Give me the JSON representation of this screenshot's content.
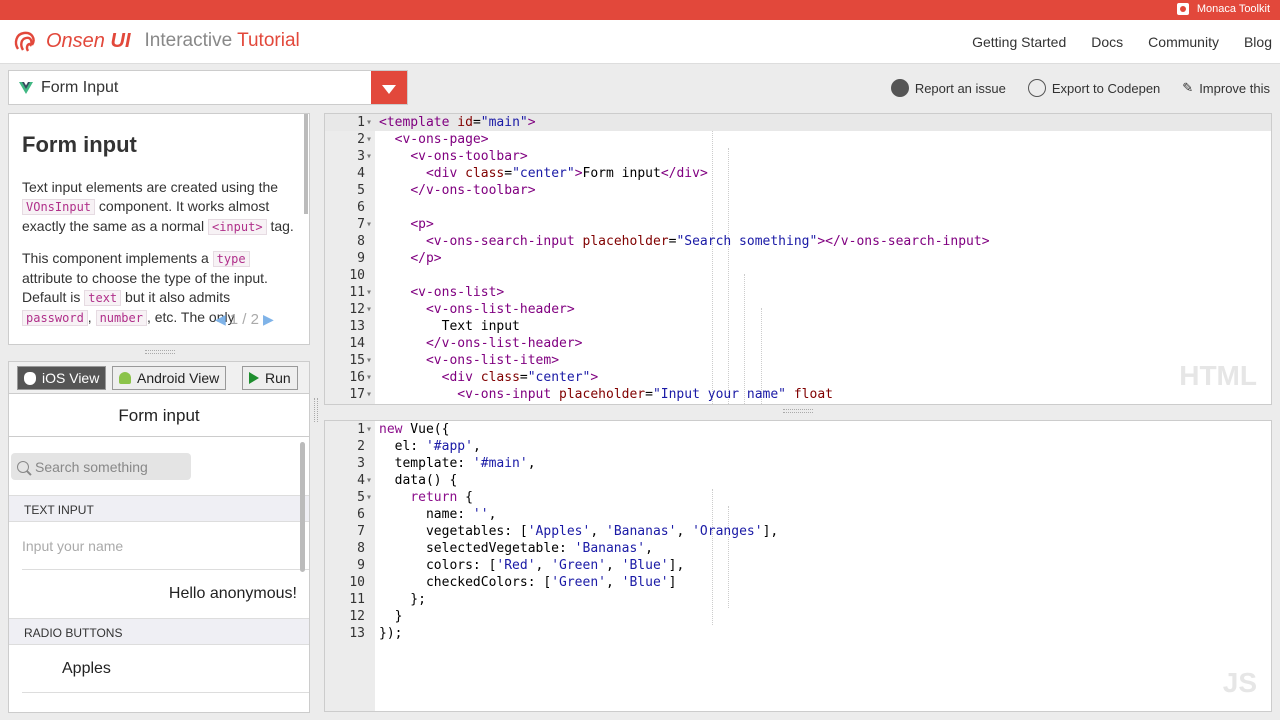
{
  "topbar": {
    "brand": "Monaca Toolkit",
    "bg": "#e2483b"
  },
  "header": {
    "logo_word1": "Onsen",
    "logo_word2": "UI",
    "subtitle1": "Interactive",
    "subtitle2": "Tutorial",
    "nav": [
      "Getting Started",
      "Docs",
      "Community",
      "Blog"
    ]
  },
  "selector": {
    "value": "Form Input"
  },
  "actions": {
    "report": "Report an issue",
    "export": "Export to Codepen",
    "improve": "Improve this"
  },
  "doc": {
    "title": "Form input",
    "p1_a": "Text input elements are created using the ",
    "p1_code1": "VOnsInput",
    "p1_b": " component. It works almost exactly the same as a normal ",
    "p1_code2": "<input>",
    "p1_c": " tag.",
    "p2_a": "This component implements a ",
    "p2_code1": "type",
    "p2_b": " attribute to choose the type of the input. Default is ",
    "p2_code2": "text",
    "p2_c": " but it also admits ",
    "p2_code3": "password",
    "p2_d": ", ",
    "p2_code4": "number",
    "p2_e": ", etc. The only",
    "pager": "1 / 2"
  },
  "preview": {
    "tab_ios": "iOS View",
    "tab_android": "Android View",
    "run": "Run",
    "toolbar_title": "Form input",
    "search_placeholder": "Search something",
    "header_text_input": "TEXT INPUT",
    "input_placeholder": "Input your name",
    "greeting": "Hello anonymous!",
    "header_radio": "RADIO BUTTONS",
    "radio_item1": "Apples"
  },
  "html_editor": {
    "lang": "HTML",
    "lines": [
      {
        "n": "1",
        "fold": true
      },
      {
        "n": "2",
        "fold": true
      },
      {
        "n": "3",
        "fold": true
      },
      {
        "n": "4",
        "fold": false
      },
      {
        "n": "5",
        "fold": false
      },
      {
        "n": "6",
        "fold": false
      },
      {
        "n": "7",
        "fold": true
      },
      {
        "n": "8",
        "fold": false
      },
      {
        "n": "9",
        "fold": false
      },
      {
        "n": "10",
        "fold": false
      },
      {
        "n": "11",
        "fold": true
      },
      {
        "n": "12",
        "fold": true
      },
      {
        "n": "13",
        "fold": false
      },
      {
        "n": "14",
        "fold": false
      },
      {
        "n": "15",
        "fold": true
      },
      {
        "n": "16",
        "fold": true
      },
      {
        "n": "17",
        "fold": true
      }
    ]
  },
  "js_editor": {
    "lang": "JS",
    "lines": [
      {
        "n": "1",
        "fold": true
      },
      {
        "n": "2",
        "fold": false
      },
      {
        "n": "3",
        "fold": false
      },
      {
        "n": "4",
        "fold": true
      },
      {
        "n": "5",
        "fold": true
      },
      {
        "n": "6",
        "fold": false
      },
      {
        "n": "7",
        "fold": false
      },
      {
        "n": "8",
        "fold": false
      },
      {
        "n": "9",
        "fold": false
      },
      {
        "n": "10",
        "fold": false
      },
      {
        "n": "11",
        "fold": false
      },
      {
        "n": "12",
        "fold": false
      },
      {
        "n": "13",
        "fold": false
      }
    ]
  }
}
